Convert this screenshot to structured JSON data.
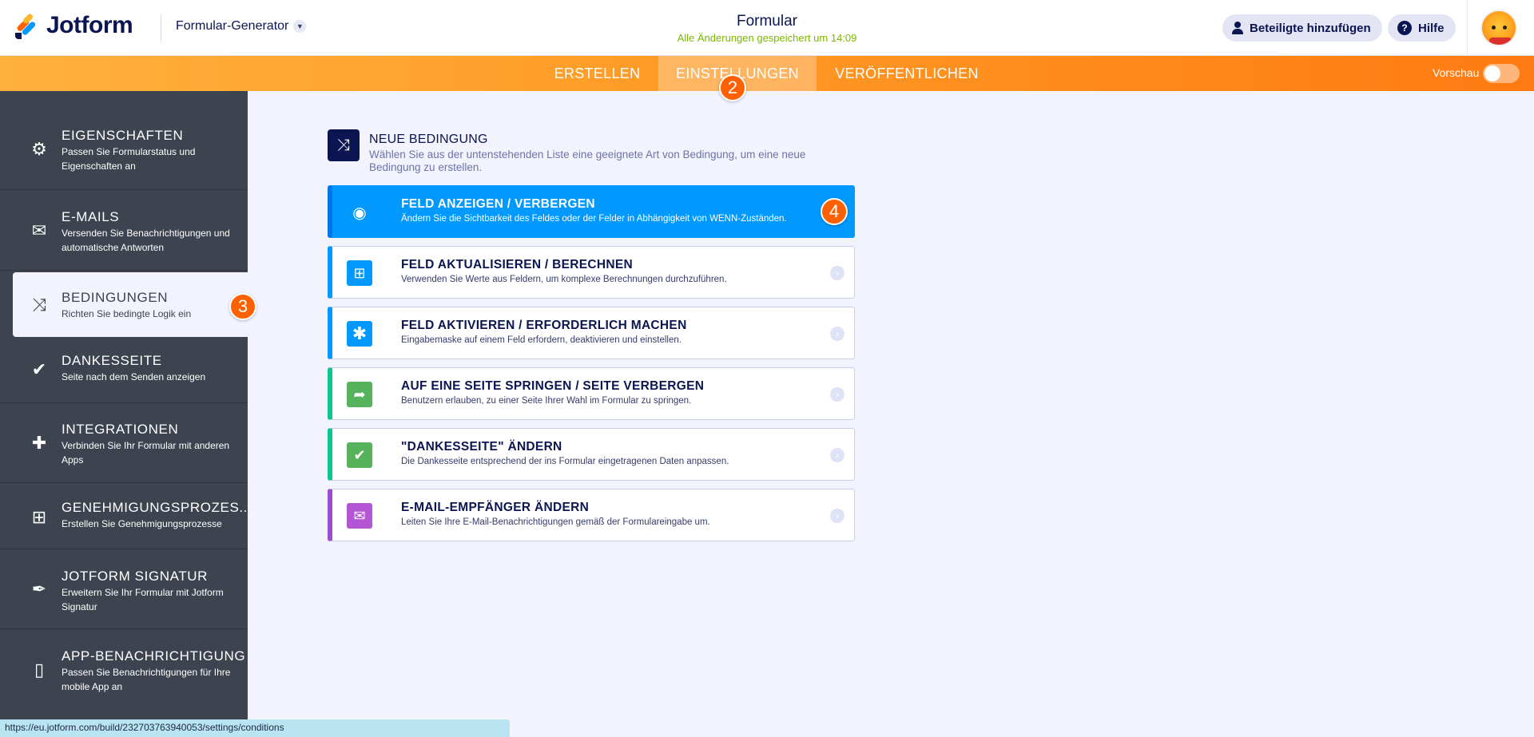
{
  "header": {
    "logo_text": "Jotform",
    "generator_label": "Formular-Generator",
    "form_title": "Formular",
    "save_status": "Alle Änderungen gespeichert um 14:09",
    "add_participants": "Beteiligte hinzufügen",
    "help": "Hilfe"
  },
  "nav": {
    "tabs": [
      {
        "label": "ERSTELLEN"
      },
      {
        "label": "EINSTELLUNGEN",
        "active": true
      },
      {
        "label": "VERÖFFENTLICHEN"
      }
    ],
    "preview_label": "Vorschau",
    "preview_on": false
  },
  "badges": {
    "settings_step": "2",
    "conditions_step": "3",
    "option_step": "4"
  },
  "sidebar": {
    "items": [
      {
        "icon": "gear-icon",
        "title": "EIGENSCHAFTEN",
        "desc": "Passen Sie Formularstatus und Eigenschaften an"
      },
      {
        "icon": "envelope-icon",
        "title": "E-MAILS",
        "desc": "Versenden Sie Benachrichtigungen und automatische Antworten"
      },
      {
        "icon": "shuffle-icon",
        "title": "BEDINGUNGEN",
        "desc": "Richten Sie bedingte Logik ein",
        "active": true
      },
      {
        "icon": "check-circle-icon",
        "title": "DANKESSEITE",
        "desc": "Seite nach dem Senden anzeigen"
      },
      {
        "icon": "puzzle-icon",
        "title": "INTEGRATIONEN",
        "desc": "Verbinden Sie Ihr Formular mit anderen Apps"
      },
      {
        "icon": "approval-flow-icon",
        "title": "GENEHMIGUNGSPROZES...",
        "desc": "Erstellen Sie Genehmigungsprozesse"
      },
      {
        "icon": "signature-pen-icon",
        "title": "JOTFORM SIGNATUR",
        "desc": "Erweitern Sie Ihr Formular mit Jotform Signatur"
      },
      {
        "icon": "mobile-notification-icon",
        "title": "APP-BENACHRICHTIGUNG",
        "desc": "Passen Sie Benachrichtigungen für Ihre mobile App an"
      }
    ]
  },
  "main": {
    "new_condition_title": "NEUE BEDINGUNG",
    "new_condition_desc": "Wählen Sie aus der untenstehenden Liste eine geeignete Art von Bedingung, um eine neue Bedingung zu erstellen.",
    "options": [
      {
        "icon": "eye-icon",
        "title": "FELD ANZEIGEN / VERBERGEN",
        "desc": "Ändern Sie die Sichtbarkeit des Feldes oder der Felder in Abhängigkeit von WENN-Zuständen.",
        "selected": true,
        "accent": "#0075e3"
      },
      {
        "icon": "calculator-icon",
        "title": "FELD AKTUALISIEREN / BERECHNEN",
        "desc": "Verwenden Sie Werte aus Feldern, um komplexe Berechnungen durchzuführen.",
        "accent": "#0099ff"
      },
      {
        "icon": "asterisk-icon",
        "title": "FELD AKTIVIEREN / ERFORDERLICH MACHEN",
        "desc": "Eingabemaske auf einem Feld erfordern, deaktivieren und einstellen.",
        "accent": "#0099ff"
      },
      {
        "icon": "jump-arrow-icon",
        "title": "AUF EINE SEITE SPRINGEN / SEITE VERBERGEN",
        "desc": "Benutzern erlauben, zu einer Seite Ihrer Wahl im Formular zu springen.",
        "accent": "#0cc68f"
      },
      {
        "icon": "check-square-icon",
        "title": "\"DANKESSEITE\" ÄNDERN",
        "desc": "Die Dankesseite entsprechend der ins Formular eingetragenen Daten anpassen.",
        "accent": "#0cc68f"
      },
      {
        "icon": "mail-icon",
        "title": "E-MAIL-EMPFÄNGER ÄNDERN",
        "desc": "Leiten Sie Ihre E-Mail-Benachrichtigungen gemäß der Formulareingabe um.",
        "accent": "#9c4dcc"
      }
    ]
  },
  "statusbar": {
    "url": "https://eu.jotform.com/build/232703763940053/settings/conditions"
  }
}
